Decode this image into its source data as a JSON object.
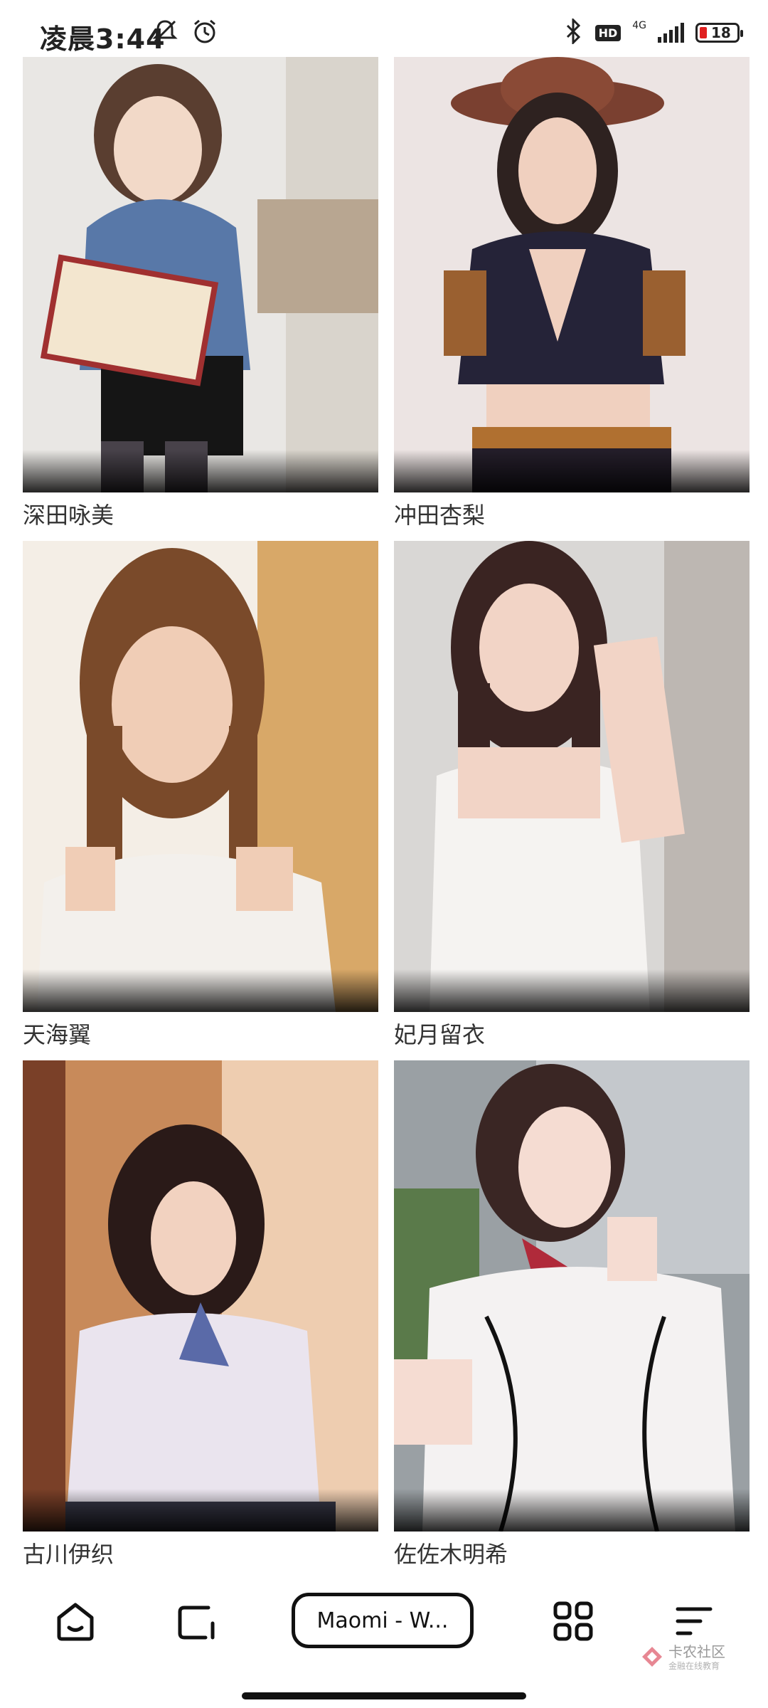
{
  "status_bar": {
    "time": "凌晨3:44",
    "hd": "HD",
    "network": "4G",
    "battery": "18"
  },
  "grid": {
    "items": [
      {
        "name": "深田咏美"
      },
      {
        "name": "冲田杏梨"
      },
      {
        "name": "天海翼"
      },
      {
        "name": "妃月留衣"
      },
      {
        "name": "古川伊织"
      },
      {
        "name": "佐佐木明希"
      }
    ]
  },
  "bottom_nav": {
    "tab_title": "Maomi - W...",
    "icons": [
      "home-icon",
      "tab-switch-icon",
      "apps-grid-icon",
      "menu-icon"
    ]
  },
  "watermark": {
    "title": "卡农社区",
    "subtitle": "金融在线教育"
  }
}
